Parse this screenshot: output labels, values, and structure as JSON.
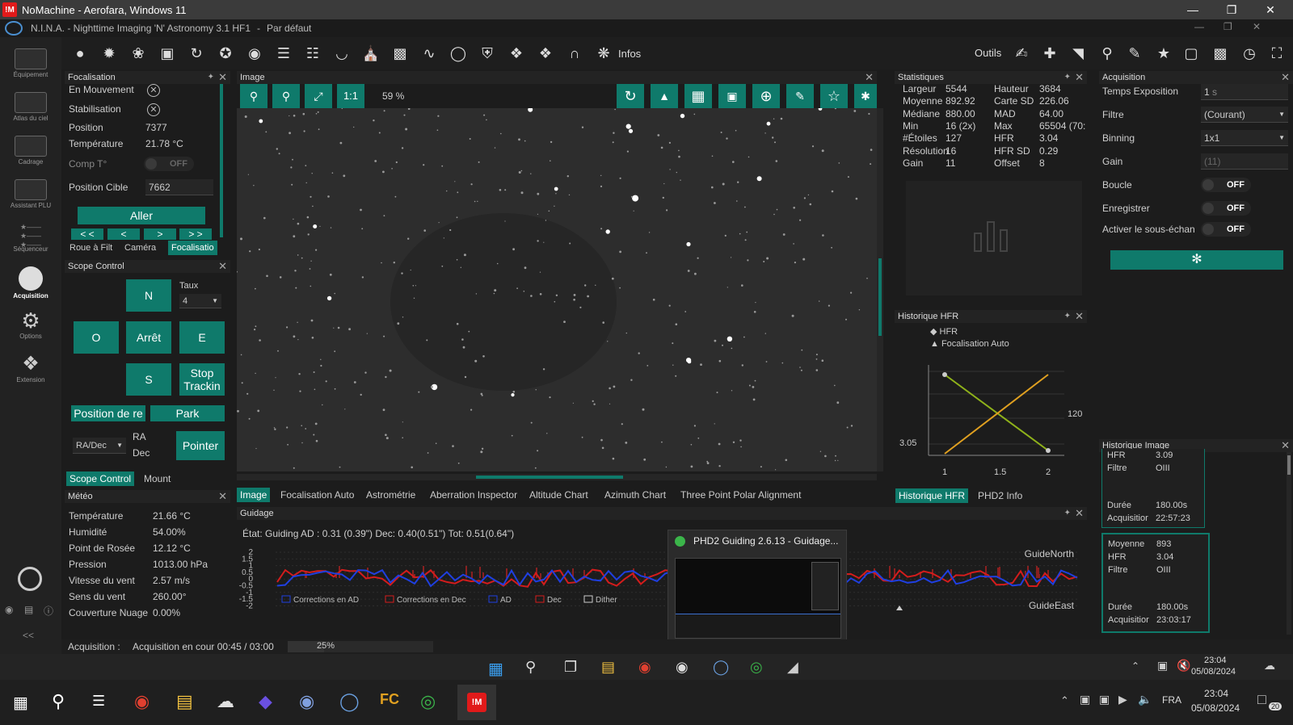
{
  "nomachine": {
    "title": "NoMachine - Aerofara, Windows 11",
    "logo": "!M"
  },
  "nina": {
    "title": "N.I.N.A. - Nighttime Imaging 'N' Astronomy 3.1 HF1",
    "profile": "Par défaut"
  },
  "sidebar": {
    "items": [
      {
        "label": "Équipement"
      },
      {
        "label": "Atlas du ciel"
      },
      {
        "label": "Cadrage"
      },
      {
        "label": "Assistant PLU"
      },
      {
        "label": "Séquenceur"
      },
      {
        "label": "Acquisition"
      },
      {
        "label": "Options"
      },
      {
        "label": "Extension"
      }
    ],
    "collapse": "<<"
  },
  "toolbar": {
    "infos": "Infos",
    "outils": "Outils"
  },
  "focus": {
    "header": "Focalisation",
    "moving_label": "En Mouvement",
    "settle_label": "Stabilisation",
    "position_label": "Position",
    "position": "7377",
    "temp_label": "Température",
    "temp": "21.78 °C",
    "comp_label": "Comp T°",
    "comp_state": "OFF",
    "target_label": "Position Cible",
    "target": "7662",
    "go": "Aller",
    "step_ll": "< <",
    "step_l": "<",
    "step_r": ">",
    "step_rr": "> >",
    "tabs": [
      "Roue à Filt",
      "Caméra",
      "Focalisatio"
    ]
  },
  "scope": {
    "header": "Scope Control",
    "n": "N",
    "o": "O",
    "stop": "Arrêt",
    "e": "E",
    "s": "S",
    "stop_tracking": "Stop Trackin",
    "rate_label": "Taux",
    "rate": "4",
    "position_de": "Position de re",
    "park": "Park",
    "coord_mode": "RA/Dec",
    "ra": "RA",
    "dec": "Dec",
    "pointer": "Pointer",
    "tabs": [
      "Scope Control",
      "Mount"
    ]
  },
  "meteo": {
    "header": "Météo",
    "rows": [
      {
        "label": "Température",
        "value": "21.66 °C"
      },
      {
        "label": "Humidité",
        "value": "54.00%"
      },
      {
        "label": "Point de Rosée",
        "value": "12.12 °C"
      },
      {
        "label": "Pression",
        "value": "1013.00 hPa"
      },
      {
        "label": "Vitesse du vent",
        "value": "2.57 m/s"
      },
      {
        "label": "Sens du vent",
        "value": "260.00°"
      },
      {
        "label": "Couverture Nuage",
        "value": "0.00%"
      }
    ]
  },
  "image": {
    "header": "Image",
    "zoom_one": "1:1",
    "zoom": "59 %",
    "tabs": [
      "Image",
      "Focalisation Auto",
      "Astrométrie",
      "Aberration Inspector",
      "Altitude Chart",
      "Azimuth Chart",
      "Three Point Polar Alignment"
    ]
  },
  "stats": {
    "header": "Statistiques",
    "left": [
      {
        "label": "Largeur",
        "value": "5544"
      },
      {
        "label": "Moyenne",
        "value": "892.92"
      },
      {
        "label": "Médiane",
        "value": "880.00"
      },
      {
        "label": "Min",
        "value": "16 (2x)"
      },
      {
        "label": "#Étoiles",
        "value": "127"
      },
      {
        "label": "Résolution",
        "value": "16"
      },
      {
        "label": "Gain",
        "value": "11"
      }
    ],
    "right": [
      {
        "label": "Hauteur",
        "value": "3684"
      },
      {
        "label": "Carte SD",
        "value": "226.06"
      },
      {
        "label": "MAD",
        "value": "64.00"
      },
      {
        "label": "Max",
        "value": "65504 (70:"
      },
      {
        "label": "HFR",
        "value": "3.04"
      },
      {
        "label": "HFR SD",
        "value": "0.29"
      },
      {
        "label": "Offset",
        "value": "8"
      }
    ]
  },
  "hfr": {
    "header": "Historique HFR",
    "legend_hfr": "HFR",
    "legend_af": "Focalisation Auto",
    "y_left": "3.05",
    "y_right": "120",
    "x_ticks": [
      "1",
      "1.5",
      "2"
    ],
    "tabs": [
      "Historique HFR",
      "PHD2 Info"
    ]
  },
  "acq": {
    "header": "Acquisition",
    "exposure_label": "Temps Exposition",
    "exposure": "1",
    "exposure_unit": "s",
    "filter_label": "Filtre",
    "filter": "(Courant)",
    "binning_label": "Binning",
    "binning": "1x1",
    "gain_label": "Gain",
    "gain": "(11)",
    "loop_label": "Boucle",
    "loop": "OFF",
    "save_label": "Enregistrer",
    "save": "OFF",
    "sub_label": "Activer le sous-échan",
    "sub": "OFF"
  },
  "imghist": {
    "header": "Historique Image",
    "item1": {
      "hfr_label": "HFR",
      "hfr": "3.09",
      "filter_label": "Filtre",
      "filter": "OIII",
      "duration_label": "Durée",
      "duration": "180.00s",
      "acq_label": "Acquisitior",
      "acq": "22:57:23"
    },
    "item2": {
      "mean_label": "Moyenne",
      "mean": "893",
      "hfr_label": "HFR",
      "hfr": "3.04",
      "filter_label": "Filtre",
      "filter": "OIII",
      "duration_label": "Durée",
      "duration": "180.00s",
      "acq_label": "Acquisitior",
      "acq": "23:03:17"
    }
  },
  "guiding": {
    "header": "Guidage",
    "status": "État: Guiding  AD : 0.31 (0.39\")  Dec: 0.40(0.51\")  Tot: 0.51(0.64\")",
    "y_ticks": [
      "2",
      "1.5",
      "1",
      "0.5",
      "0",
      "-0.5",
      "-1",
      "-1.5",
      "-2"
    ],
    "north": "GuideNorth",
    "east": "GuideEast",
    "legend": [
      "Corrections en AD",
      "Corrections en Dec",
      "AD",
      "Dec",
      "Dither"
    ]
  },
  "phd2_popup": {
    "title": "PHD2 Guiding 2.6.13 - Guidage..."
  },
  "status": {
    "label": "Acquisition :",
    "text": "Acquisition en cour 00:45 / 03:00",
    "percent": "25%",
    "progress": 0.25
  },
  "nm_taskbar": {
    "time": "23:04",
    "date": "05/08/2024",
    "notif": "20"
  },
  "win_taskbar": {
    "time": "23:04",
    "date": "05/08/2024",
    "lang": "FRA"
  },
  "colors": {
    "accent": "#0f7a6b",
    "ad_line": "#1f3fe0",
    "dec_line": "#d41c1c"
  }
}
